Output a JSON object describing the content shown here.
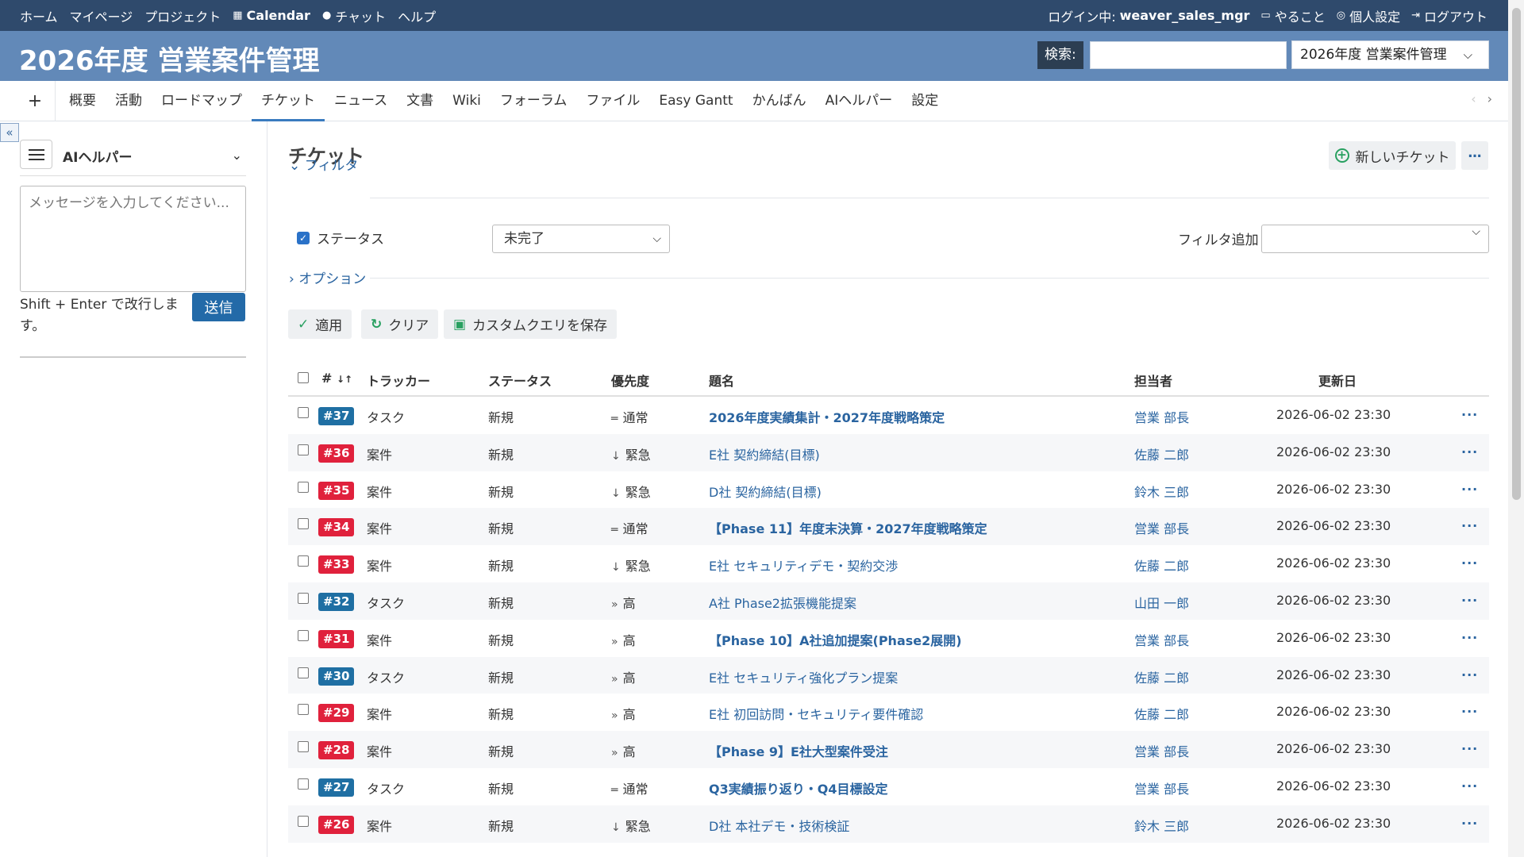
{
  "top_menu": {
    "links": [
      "ホーム",
      "マイページ",
      "プロジェクト"
    ],
    "calendar": "Calendar",
    "chat": "チャット",
    "help": "ヘルプ",
    "login_prefix": "ログイン中:",
    "login_user": "weaver_sales_mgr",
    "todo": "やること",
    "my_account": "個人設定",
    "logout": "ログアウト"
  },
  "header": {
    "title": "2026年度 営業案件管理",
    "search_label": "検索:",
    "search_value": "",
    "project_select": "2026年度 営業案件管理"
  },
  "main_menu": {
    "add": "+",
    "tabs": [
      "概要",
      "活動",
      "ロードマップ",
      "チケット",
      "ニュース",
      "文書",
      "Wiki",
      "フォーラム",
      "ファイル",
      "Easy Gantt",
      "かんばん",
      "AIヘルパー",
      "設定"
    ],
    "selected": "チケット"
  },
  "sidebar": {
    "ai_title": "AIヘルパー",
    "placeholder": "メッセージを入力してください...",
    "hint": "Shift + Enter で改行します。",
    "send": "送信"
  },
  "content": {
    "title": "チケット",
    "new_issue": "新しいチケット",
    "more": "…",
    "filter_toggle": "フィルタ",
    "status_label": "ステータス",
    "status_value": "未完了",
    "add_filter_label": "フィルタ追加",
    "options_toggle": "オプション",
    "apply": "適用",
    "clear": "クリア",
    "save_query": "カスタムクエリを保存"
  },
  "table": {
    "headers": {
      "id": "#",
      "tracker": "トラッカー",
      "status": "ステータス",
      "priority": "優先度",
      "subject": "題名",
      "assignee": "担当者",
      "updated": "更新日"
    },
    "rows": [
      {
        "id": "#37",
        "tracker": "タスク",
        "status": "新規",
        "priority": "通常",
        "subject": "2026年度実績集計・2027年度戦略策定",
        "assignee": "営業 部長",
        "updated": "2026-06-02 23:30",
        "bold": true
      },
      {
        "id": "#36",
        "tracker": "案件",
        "status": "新規",
        "priority": "緊急",
        "subject": "E社 契約締結(目標)",
        "assignee": "佐藤 二郎",
        "updated": "2026-06-02 23:30",
        "bold": false
      },
      {
        "id": "#35",
        "tracker": "案件",
        "status": "新規",
        "priority": "緊急",
        "subject": "D社 契約締結(目標)",
        "assignee": "鈴木 三郎",
        "updated": "2026-06-02 23:30",
        "bold": false
      },
      {
        "id": "#34",
        "tracker": "案件",
        "status": "新規",
        "priority": "通常",
        "subject": "【Phase 11】年度末決算・2027年度戦略策定",
        "assignee": "営業 部長",
        "updated": "2026-06-02 23:30",
        "bold": true
      },
      {
        "id": "#33",
        "tracker": "案件",
        "status": "新規",
        "priority": "緊急",
        "subject": "E社 セキュリティデモ・契約交渉",
        "assignee": "佐藤 二郎",
        "updated": "2026-06-02 23:30",
        "bold": false
      },
      {
        "id": "#32",
        "tracker": "タスク",
        "status": "新規",
        "priority": "高",
        "subject": "A社 Phase2拡張機能提案",
        "assignee": "山田 一郎",
        "updated": "2026-06-02 23:30",
        "bold": false
      },
      {
        "id": "#31",
        "tracker": "案件",
        "status": "新規",
        "priority": "高",
        "subject": "【Phase 10】A社追加提案(Phase2展開)",
        "assignee": "営業 部長",
        "updated": "2026-06-02 23:30",
        "bold": true
      },
      {
        "id": "#30",
        "tracker": "タスク",
        "status": "新規",
        "priority": "高",
        "subject": "E社 セキュリティ強化プラン提案",
        "assignee": "佐藤 二郎",
        "updated": "2026-06-02 23:30",
        "bold": false
      },
      {
        "id": "#29",
        "tracker": "案件",
        "status": "新規",
        "priority": "高",
        "subject": "E社 初回訪問・セキュリティ要件確認",
        "assignee": "佐藤 二郎",
        "updated": "2026-06-02 23:30",
        "bold": false
      },
      {
        "id": "#28",
        "tracker": "案件",
        "status": "新規",
        "priority": "高",
        "subject": "【Phase 9】E社大型案件受注",
        "assignee": "営業 部長",
        "updated": "2026-06-02 23:30",
        "bold": true
      },
      {
        "id": "#27",
        "tracker": "タスク",
        "status": "新規",
        "priority": "通常",
        "subject": "Q3実績振り返り・Q4目標設定",
        "assignee": "営業 部長",
        "updated": "2026-06-02 23:30",
        "bold": true
      },
      {
        "id": "#26",
        "tracker": "案件",
        "status": "新規",
        "priority": "緊急",
        "subject": "D社 本社デモ・技術検証",
        "assignee": "鈴木 三郎",
        "updated": "2026-06-02 23:30",
        "bold": false
      }
    ]
  },
  "colors": {
    "top_bar": "#2f4a6c",
    "header": "#6289b8",
    "task_badge": "#1f6fa3",
    "case_badge": "#e0213c",
    "link": "#2a64a0"
  }
}
